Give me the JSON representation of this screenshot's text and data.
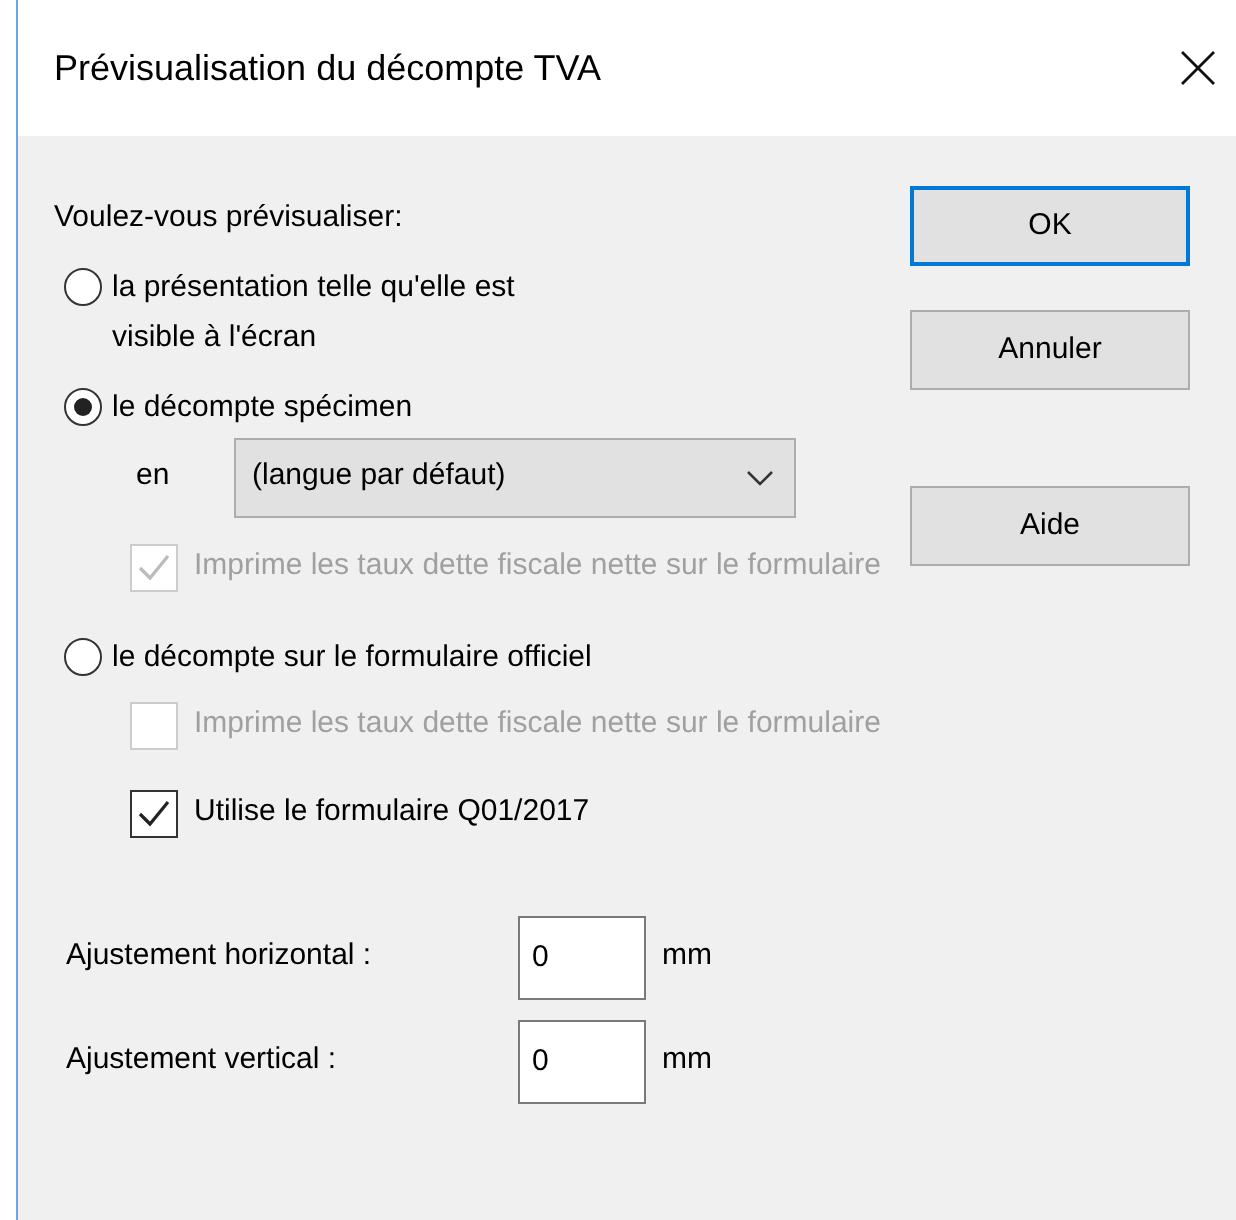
{
  "window": {
    "title": "Prévisualisation du décompte TVA"
  },
  "prompt": "Voulez-vous prévisualiser:",
  "options": [
    {
      "label": "la présentation telle qu'elle est visible à l'écran",
      "selected": false
    },
    {
      "label": "le décompte spécimen",
      "selected": true,
      "language": {
        "label": "en",
        "value": "(langue par défaut)"
      },
      "checkboxes": [
        {
          "label": "Imprime les taux dette fiscale nette sur le formulaire",
          "checked": true,
          "disabled": true
        }
      ]
    },
    {
      "label": "le décompte sur le formulaire officiel",
      "selected": false,
      "checkboxes": [
        {
          "label": "Imprime les taux dette fiscale nette sur le formulaire",
          "checked": false,
          "disabled": true
        },
        {
          "label": "Utilise le formulaire Q01/2017",
          "checked": true,
          "disabled": false
        }
      ]
    }
  ],
  "adjustments": [
    {
      "label": "Ajustement horizontal :",
      "value": "0",
      "unit": "mm"
    },
    {
      "label": "Ajustement vertical :",
      "value": "0",
      "unit": "mm"
    }
  ],
  "buttons": [
    {
      "label": "OK",
      "focused": true
    },
    {
      "label": "Annuler",
      "focused": false
    },
    {
      "label": "Aide",
      "focused": false
    }
  ]
}
